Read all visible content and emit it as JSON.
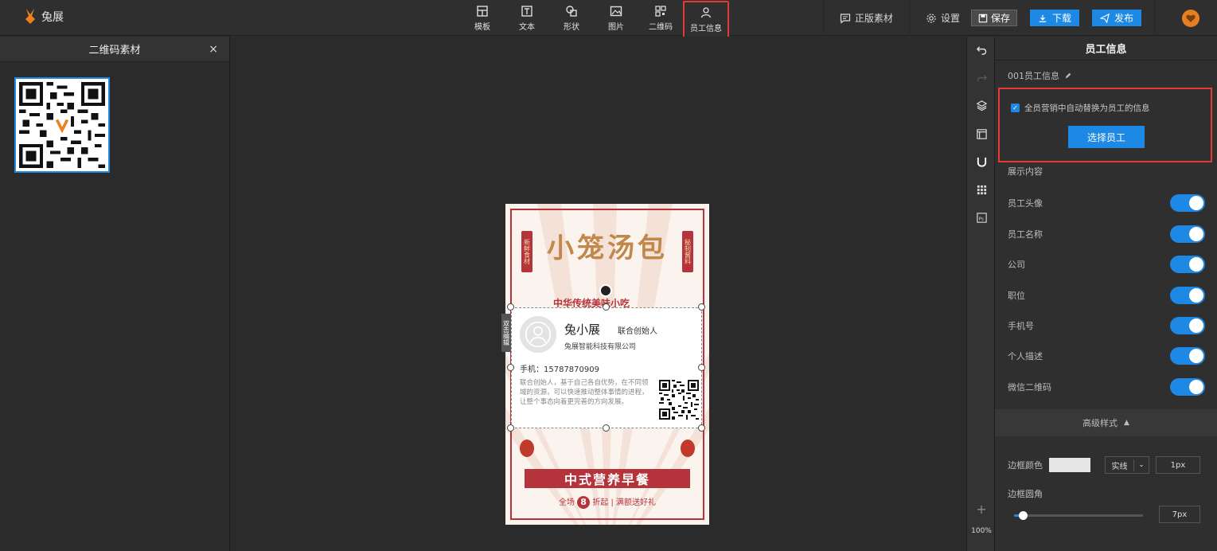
{
  "app": {
    "name": "兔展"
  },
  "toolbar": {
    "tools": [
      {
        "label": "模板",
        "icon": "template-icon"
      },
      {
        "label": "文本",
        "icon": "text-icon"
      },
      {
        "label": "形状",
        "icon": "shape-icon"
      },
      {
        "label": "图片",
        "icon": "image-icon"
      },
      {
        "label": "二维码",
        "icon": "qrcode-icon"
      },
      {
        "label": "员工信息",
        "icon": "user-icon"
      }
    ],
    "genuine_label": "正版素材",
    "settings_label": "设置",
    "save_label": "保存",
    "download_label": "下载",
    "publish_label": "发布"
  },
  "left_panel": {
    "title": "二维码素材",
    "close": "×"
  },
  "canvas": {
    "poster": {
      "title": "小笼汤包",
      "left_vertical": "新鲜食材",
      "right_vertical": "秘制酱料",
      "subtitle": "中华传统美味小吃",
      "banner": "中式营养早餐",
      "promo_prefix": "全场",
      "promo_num": "8",
      "promo_mid": "折起",
      "promo_suffix": "满额送好礼"
    },
    "card": {
      "name": "兔小展",
      "position": "联合创始人",
      "company": "兔展智能科技有限公司",
      "phone": "手机：15787870909",
      "description": "联合创始人，基于自己各自优势，在不同领域的资源，可以快速推动整体事情的进程，让整个事态向着更完善的方向发展。"
    },
    "side_tag": "双击编辑"
  },
  "icon_bar": {
    "zoom": "100%",
    "add": "+"
  },
  "right_panel": {
    "title": "员工信息",
    "item_name": "001员工信息",
    "auto_replace_label": "全员营销中自动替换为员工的信息",
    "auto_replace_checked": true,
    "select_button": "选择员工",
    "display_title": "展示内容",
    "toggles": [
      {
        "label": "员工头像",
        "on": true
      },
      {
        "label": "员工名称",
        "on": true
      },
      {
        "label": "公司",
        "on": true
      },
      {
        "label": "职位",
        "on": true
      },
      {
        "label": "手机号",
        "on": true
      },
      {
        "label": "个人描述",
        "on": true
      },
      {
        "label": "微信二维码",
        "on": true
      }
    ],
    "advanced_label": "高级样式",
    "border_color_label": "边框颜色",
    "border_color": "#e6e6e6",
    "border_style": "实线",
    "border_width": "1px",
    "border_radius_label": "边框圆角",
    "border_radius_value": "7px",
    "border_radius_fraction": 0.07
  },
  "colors": {
    "accent": "#1e88e5",
    "highlight": "#e53935",
    "poster_red": "#b5333b"
  }
}
